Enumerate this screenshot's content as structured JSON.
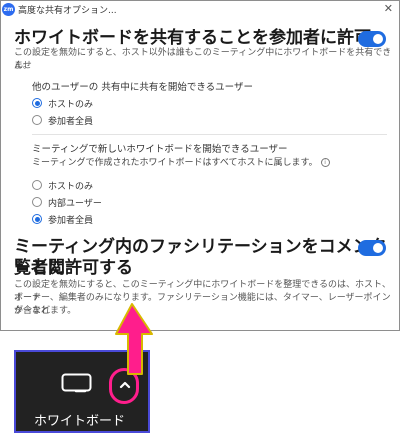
{
  "window": {
    "title": "高度な共有オプション...",
    "app_icon_text": "zm",
    "close_symbol": "✕"
  },
  "whiteboard_share": {
    "heading": "ホワイトボードを共有することを参加者に許可",
    "description_line1": "この設定を無効にすると、ホスト以外は誰もこのミーティング中にホワイトボードを共有できませ",
    "description_line2": "ん。",
    "toggle_on": true,
    "group1": {
      "title": "他のユーザーの 共有中に共有を開始できるユーザー",
      "options": [
        {
          "label": "ホストのみ",
          "selected": true
        },
        {
          "label": "参加者全員",
          "selected": false
        }
      ]
    },
    "group2": {
      "title": "ミーティングで新しいホワイトボードを開始できるユーザー",
      "subtitle": "ミーティングで作成されたホワイトボードはすべてホストに属します。",
      "info_icon": "ⓘ",
      "options": [
        {
          "label": "ホストのみ",
          "selected": false
        },
        {
          "label": "内部ユーザー",
          "selected": false
        },
        {
          "label": "参加者全員",
          "selected": true
        }
      ]
    }
  },
  "facilitation": {
    "heading_line1": "ミーティング内のファシリテーションをコメンターと閲",
    "heading_line2": "覧者に許可する",
    "toggle_on": true,
    "description_line1": "この設定を無効にすると、このミーティング中にホワイトボードを整理できるのは、ホスト、ボード",
    "description_line2": "オーナー、編集者のみになります。ファシリテーション機能には、タイマー、レーザーポインターなど",
    "description_line3": "が含まれます。"
  },
  "toolbar": {
    "whiteboard_label": "ホワイトボード",
    "highlight_color": "#ff1e8c"
  }
}
